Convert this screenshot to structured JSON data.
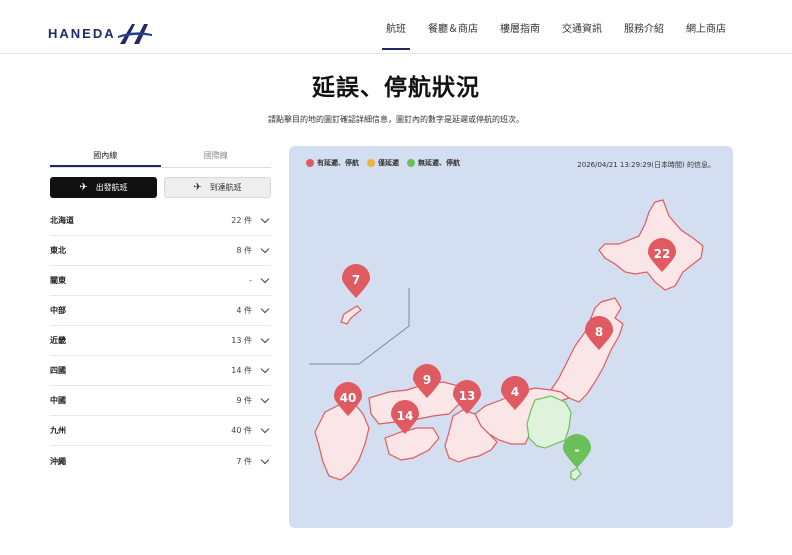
{
  "header": {
    "logo_text": "HANEDA",
    "nav": [
      "航班",
      "餐廳＆商店",
      "樓層指南",
      "交通資訊",
      "服務介紹",
      "網上商店"
    ],
    "active_nav": 0
  },
  "page": {
    "title": "延誤、停航狀況",
    "subtitle": "請點擊目的地的圖釘確認詳細信息，圖釘內的數字是延遲或停航的班次。"
  },
  "tabs": {
    "domestic": "國內線",
    "international": "國際線"
  },
  "direction": {
    "departure": "出發航班",
    "arrival": "到達航班"
  },
  "regions": [
    {
      "name": "北海道",
      "count": "22 件"
    },
    {
      "name": "東北",
      "count": "8 件"
    },
    {
      "name": "關東",
      "count": "-"
    },
    {
      "name": "中部",
      "count": "4 件"
    },
    {
      "name": "近畿",
      "count": "13 件"
    },
    {
      "name": "四國",
      "count": "14 件"
    },
    {
      "name": "中國",
      "count": "9 件"
    },
    {
      "name": "九州",
      "count": "40 件"
    },
    {
      "name": "沖繩",
      "count": "7 件"
    }
  ],
  "legend": {
    "delay_cancel": "有延遲、停航",
    "delay_only": "僅延遲",
    "none": "無延遲、停航"
  },
  "colors": {
    "red": "#e05a62",
    "orange": "#f0b23e",
    "green": "#6cc05a",
    "region_red_fill": "#fbe6e7",
    "region_red_stroke": "#e05a62",
    "region_green_fill": "#dff3dc",
    "region_green_stroke": "#6cc05a",
    "map_bg": "#d3dff0",
    "brand": "#1f2a66"
  },
  "timestamp": "2026/04/21 13:29:29(日本時間) 的信息。",
  "pins": {
    "hokkaido": "22",
    "tohoku": "8",
    "chubu": "4",
    "kinki": "13",
    "shikoku": "14",
    "chugoku": "9",
    "kyushu": "40",
    "okinawa": "7",
    "kanto": "-"
  }
}
